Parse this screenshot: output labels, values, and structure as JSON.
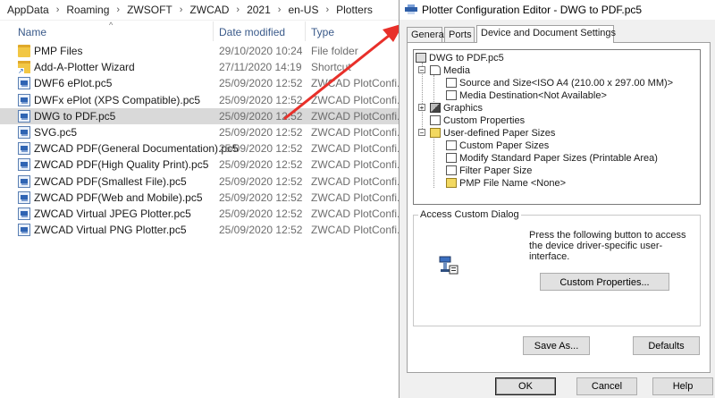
{
  "breadcrumb": [
    "AppData",
    "Roaming",
    "ZWSOFT",
    "ZWCAD",
    "2021",
    "en-US",
    "Plotters"
  ],
  "columns": {
    "name": "Name",
    "date": "Date modified",
    "type": "Type"
  },
  "files": [
    {
      "name": "PMP Files",
      "date": "29/10/2020 10:24",
      "type": "File folder",
      "icon": "folder-icon"
    },
    {
      "name": "Add-A-Plotter Wizard",
      "date": "27/11/2020 14:19",
      "type": "Shortcut",
      "icon": "shortcut-icon"
    },
    {
      "name": "DWF6 ePlot.pc5",
      "date": "25/09/2020 12:52",
      "type": "ZWCAD PlotConfi...",
      "icon": "pc5-file-icon"
    },
    {
      "name": "DWFx ePlot (XPS Compatible).pc5",
      "date": "25/09/2020 12:52",
      "type": "ZWCAD PlotConfi...",
      "icon": "pc5-file-icon"
    },
    {
      "name": "DWG to PDF.pc5",
      "date": "25/09/2020 12:52",
      "type": "ZWCAD PlotConfi...",
      "icon": "pc5-file-icon",
      "selected": true
    },
    {
      "name": "SVG.pc5",
      "date": "25/09/2020 12:52",
      "type": "ZWCAD PlotConfi...",
      "icon": "pc5-file-icon"
    },
    {
      "name": "ZWCAD PDF(General Documentation).pc5",
      "date": "25/09/2020 12:52",
      "type": "ZWCAD PlotConfi...",
      "icon": "pc5-file-icon"
    },
    {
      "name": "ZWCAD PDF(High Quality Print).pc5",
      "date": "25/09/2020 12:52",
      "type": "ZWCAD PlotConfi...",
      "icon": "pc5-file-icon"
    },
    {
      "name": "ZWCAD PDF(Smallest File).pc5",
      "date": "25/09/2020 12:52",
      "type": "ZWCAD PlotConfi...",
      "icon": "pc5-file-icon"
    },
    {
      "name": "ZWCAD PDF(Web and Mobile).pc5",
      "date": "25/09/2020 12:52",
      "type": "ZWCAD PlotConfi...",
      "icon": "pc5-file-icon"
    },
    {
      "name": "ZWCAD Virtual JPEG Plotter.pc5",
      "date": "25/09/2020 12:52",
      "type": "ZWCAD PlotConfi...",
      "icon": "pc5-file-icon"
    },
    {
      "name": "ZWCAD Virtual PNG Plotter.pc5",
      "date": "25/09/2020 12:52",
      "type": "ZWCAD PlotConfi...",
      "icon": "pc5-file-icon"
    }
  ],
  "dialog": {
    "title": "Plotter Configuration Editor - DWG to PDF.pc5",
    "tabs": [
      "General",
      "Ports",
      "Device and Document Settings"
    ],
    "tree": {
      "root": "DWG to PDF.pc5",
      "media": "Media",
      "source_size": "Source and Size<ISO A4 (210.00 x 297.00 MM)>",
      "media_destination": "Media Destination<Not Available>",
      "graphics": "Graphics",
      "custom_properties": "Custom Properties",
      "user_paper_sizes": "User-defined Paper Sizes",
      "custom_paper_sizes": "Custom Paper Sizes",
      "modify_standard": "Modify Standard Paper Sizes (Printable Area)",
      "filter_paper": "Filter Paper Size",
      "pmp_file": "PMP File Name <None>"
    },
    "group_label": "Access Custom Dialog",
    "description": "Press the following button to access the device driver-specific user-interface.",
    "buttons": {
      "custom_properties": "Custom Properties...",
      "save_as": "Save As...",
      "defaults": "Defaults",
      "ok": "OK",
      "cancel": "Cancel",
      "help": "Help"
    }
  },
  "colors": {
    "arrow": "#e8302a",
    "selected_row": "#d9d9d9"
  }
}
